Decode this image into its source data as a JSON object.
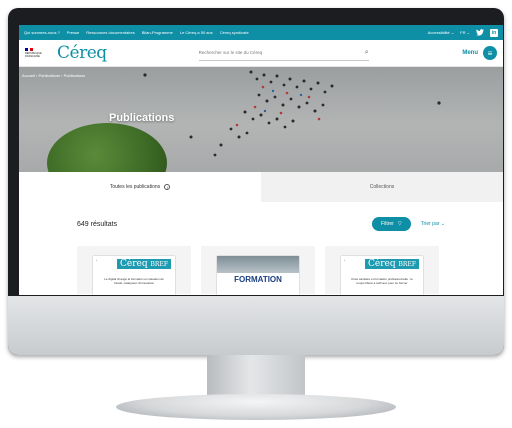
{
  "topbar": {
    "nav": [
      "Qui sommes-nous ?",
      "Presse",
      "Ressources documentaires",
      "Bilan-Programme",
      "Le Céreq a 50 ans",
      "Céreq syndicate"
    ],
    "accessibility": "Accessibilité",
    "language": "FR"
  },
  "header": {
    "rf_lines": [
      "RÉPUBLIQUE",
      "FRANÇAISE"
    ],
    "logo": "Céreq",
    "search_placeholder": "Rechercher sur le site du Céreq",
    "menu_label": "Menu"
  },
  "hero": {
    "breadcrumb": "Accueil  ›  Publications  ›  Publications",
    "title": "Publications"
  },
  "tabs": [
    {
      "label": "Toutes les publications",
      "active": true
    },
    {
      "label": "Collections",
      "active": false
    }
  ],
  "results": {
    "count": "649 résultats",
    "filter_label": "Filtrer",
    "sort_label": "Trier par"
  },
  "cards": [
    {
      "brand": "Céreq",
      "series": "BREF",
      "text": "Le digital change la formation en situation de travail, catalyseur d'innovation"
    },
    {
      "title": "FORMATION"
    },
    {
      "brand": "Céreq",
      "series": "BREF",
      "text": "Crise sanitaire et formation professionnelle : le temps libéré a suffi aux pour se former"
    }
  ],
  "colors": {
    "brand": "#0e8fa6"
  },
  "icons": {
    "twitter": "twitter-icon",
    "linkedin": "linkedin-icon",
    "search": "search-icon",
    "menu": "menu-icon",
    "info": "info-icon",
    "filter": "filter-icon"
  }
}
